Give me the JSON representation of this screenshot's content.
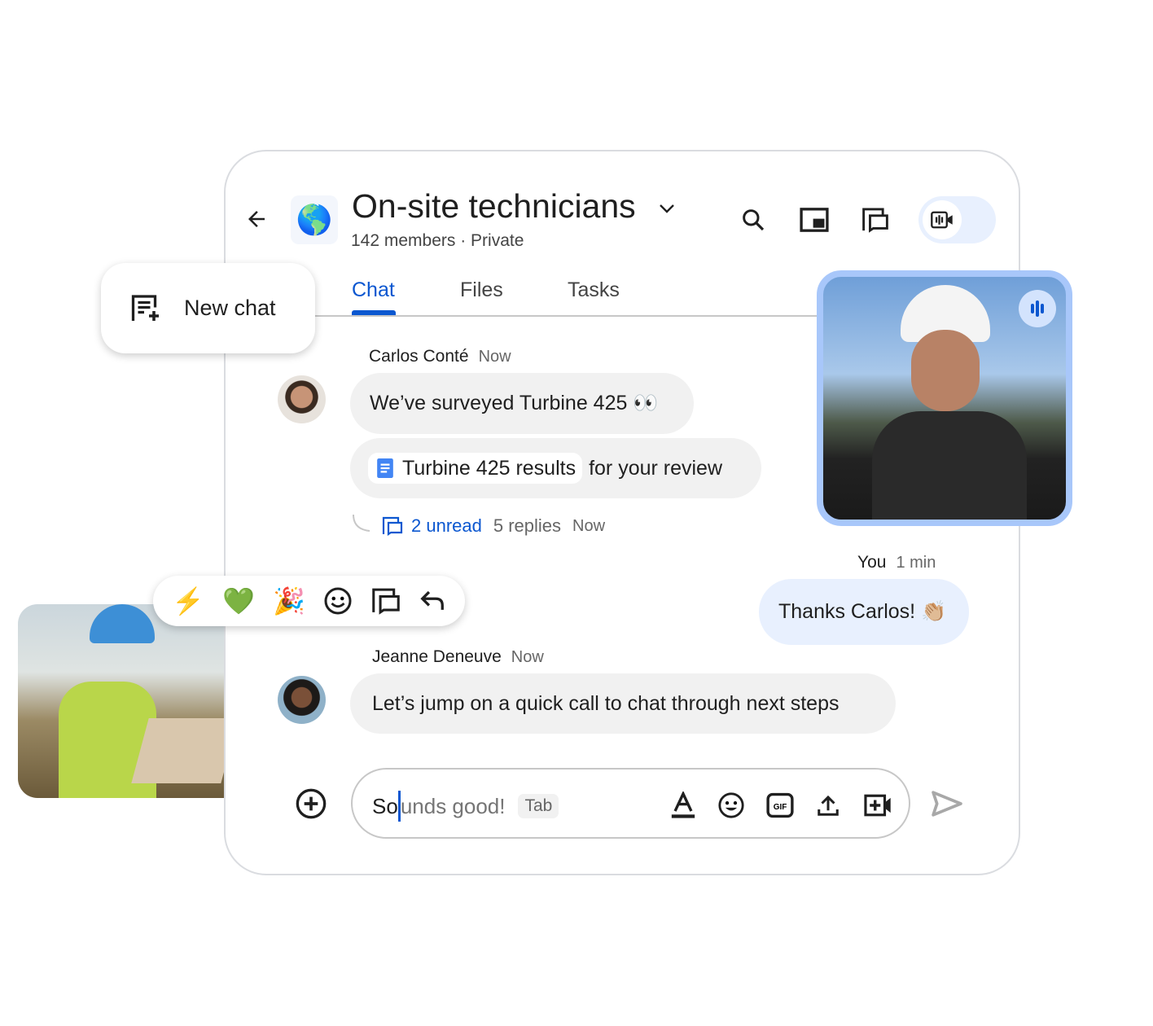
{
  "header": {
    "title": "On-site technicians",
    "subtitle": "142 members · Private",
    "icons": [
      "arrow-back-icon",
      "globe-icon",
      "chevron-down-icon",
      "search-icon",
      "picture-in-picture-icon",
      "threads-icon",
      "video-call-active-icon"
    ]
  },
  "tabs": [
    {
      "label": "Chat",
      "active": true
    },
    {
      "label": "Files"
    },
    {
      "label": "Tasks"
    }
  ],
  "new_chat": {
    "label": "New chat"
  },
  "messages": [
    {
      "sender": "Carlos Conté",
      "time": "Now",
      "text": "We’ve surveyed Turbine 425 👀",
      "attachment": {
        "title": "Turbine 425 results",
        "suffix": "for your review"
      },
      "thread": {
        "unread": "2 unread",
        "replies": "5 replies",
        "time": "Now"
      }
    },
    {
      "sender": "You",
      "time": "1 min",
      "text": "Thanks Carlos! 👏🏼"
    },
    {
      "sender": "Jeanne Deneuve",
      "time": "Now",
      "text": "Let’s jump on a quick call to chat through next steps"
    }
  ],
  "reactions": [
    "⚡",
    "💚",
    "🎉"
  ],
  "composer": {
    "typed": "So",
    "suggestion": "unds good!",
    "tab_hint": "Tab"
  },
  "colors": {
    "accent": "#0b57d0",
    "bubble": "#f1f1f1",
    "own_bubble": "#e8f0fe",
    "video_border": "#a8c7fa"
  }
}
